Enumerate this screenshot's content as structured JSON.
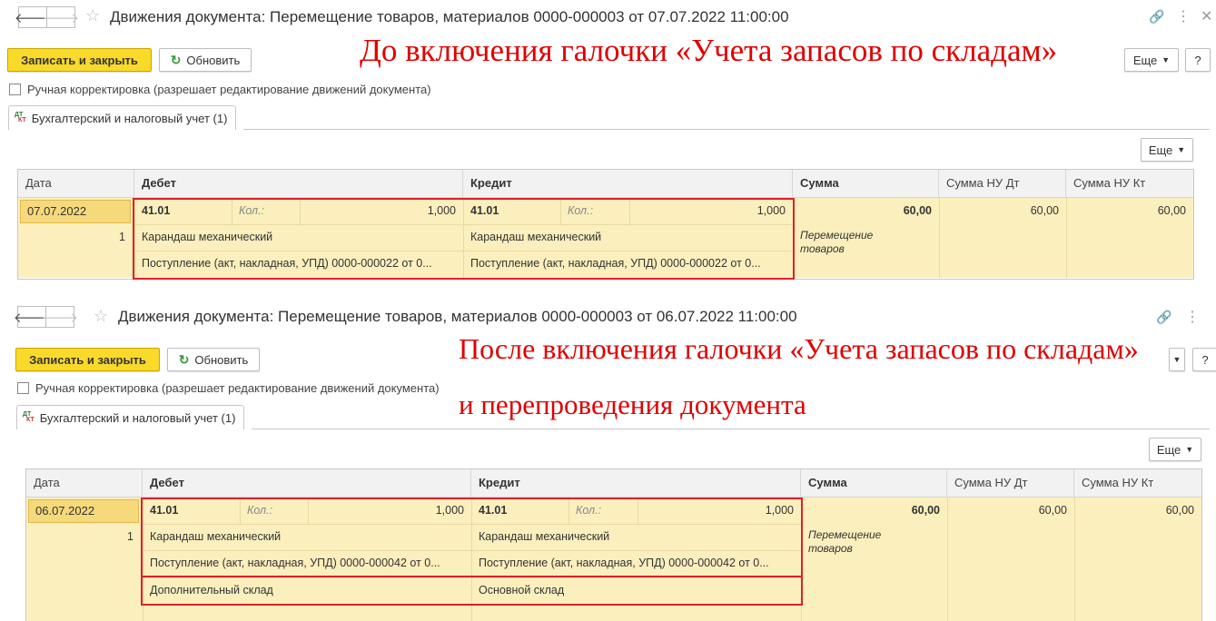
{
  "top": {
    "title": "Движения документа: Перемещение товаров, материалов 0000-000003 от 07.07.2022 11:00:00",
    "save_close": "Записать и закрыть",
    "refresh": "Обновить",
    "more": "Еще",
    "help": "?",
    "manual_check": "Ручная корректировка (разрешает редактирование движений документа)",
    "tab": "Бухгалтерский и налоговый учет (1)",
    "table_more": "Еще",
    "note": "До включения галочки «Учета запасов по складам»",
    "columns": [
      "Дата",
      "Дебет",
      "Кредит",
      "Сумма",
      "Сумма НУ Дт",
      "Сумма НУ Кт"
    ],
    "row": {
      "date": "07.07.2022",
      "num": "1",
      "debit_account": "41.01",
      "debit_qty_label": "Кол.:",
      "debit_qty": "1,000",
      "credit_account": "41.01",
      "credit_qty_label": "Кол.:",
      "credit_qty": "1,000",
      "sum": "60,00",
      "sum_nu_dt": "60,00",
      "sum_nu_kt": "60,00",
      "debit_item": "Карандаш механический",
      "credit_item": "Карандаш механический",
      "debit_doc": "Поступление (акт, накладная, УПД) 0000-000022 от 0...",
      "credit_doc": "Поступление (акт, накладная, УПД) 0000-000022 от 0...",
      "content_1": "Перемещение",
      "content_2": "товаров"
    }
  },
  "bottom": {
    "title": "Движения документа: Перемещение товаров, материалов 0000-000003 от 06.07.2022 11:00:00",
    "save_close": "Записать и закрыть",
    "refresh": "Обновить",
    "help": "?",
    "manual_check": "Ручная корректировка (разрешает редактирование движений документа)",
    "tab": "Бухгалтерский и налоговый учет (1)",
    "table_more": "Еще",
    "note_1": "После включения галочки «Учета запасов по складам»",
    "note_2": "и перепроведения документа",
    "columns": [
      "Дата",
      "Дебет",
      "Кредит",
      "Сумма",
      "Сумма НУ Дт",
      "Сумма НУ Кт"
    ],
    "row": {
      "date": "06.07.2022",
      "num": "1",
      "debit_account": "41.01",
      "debit_qty_label": "Кол.:",
      "debit_qty": "1,000",
      "credit_account": "41.01",
      "credit_qty_label": "Кол.:",
      "credit_qty": "1,000",
      "sum": "60,00",
      "sum_nu_dt": "60,00",
      "sum_nu_kt": "60,00",
      "debit_item": "Карандаш механический",
      "credit_item": "Карандаш механический",
      "debit_doc": "Поступление (акт, накладная, УПД) 0000-000042 от 0...",
      "credit_doc": "Поступление (акт, накладная, УПД) 0000-000042 от 0...",
      "content_1": "Перемещение",
      "content_2": "товаров",
      "debit_warehouse": "Дополнительный склад",
      "credit_warehouse": "Основной склад"
    }
  },
  "colors": {
    "accent_yellow": "#f9da2b",
    "row_bg": "#fbefbe",
    "highlight": "#e0202a",
    "note_red": "#e00000"
  }
}
